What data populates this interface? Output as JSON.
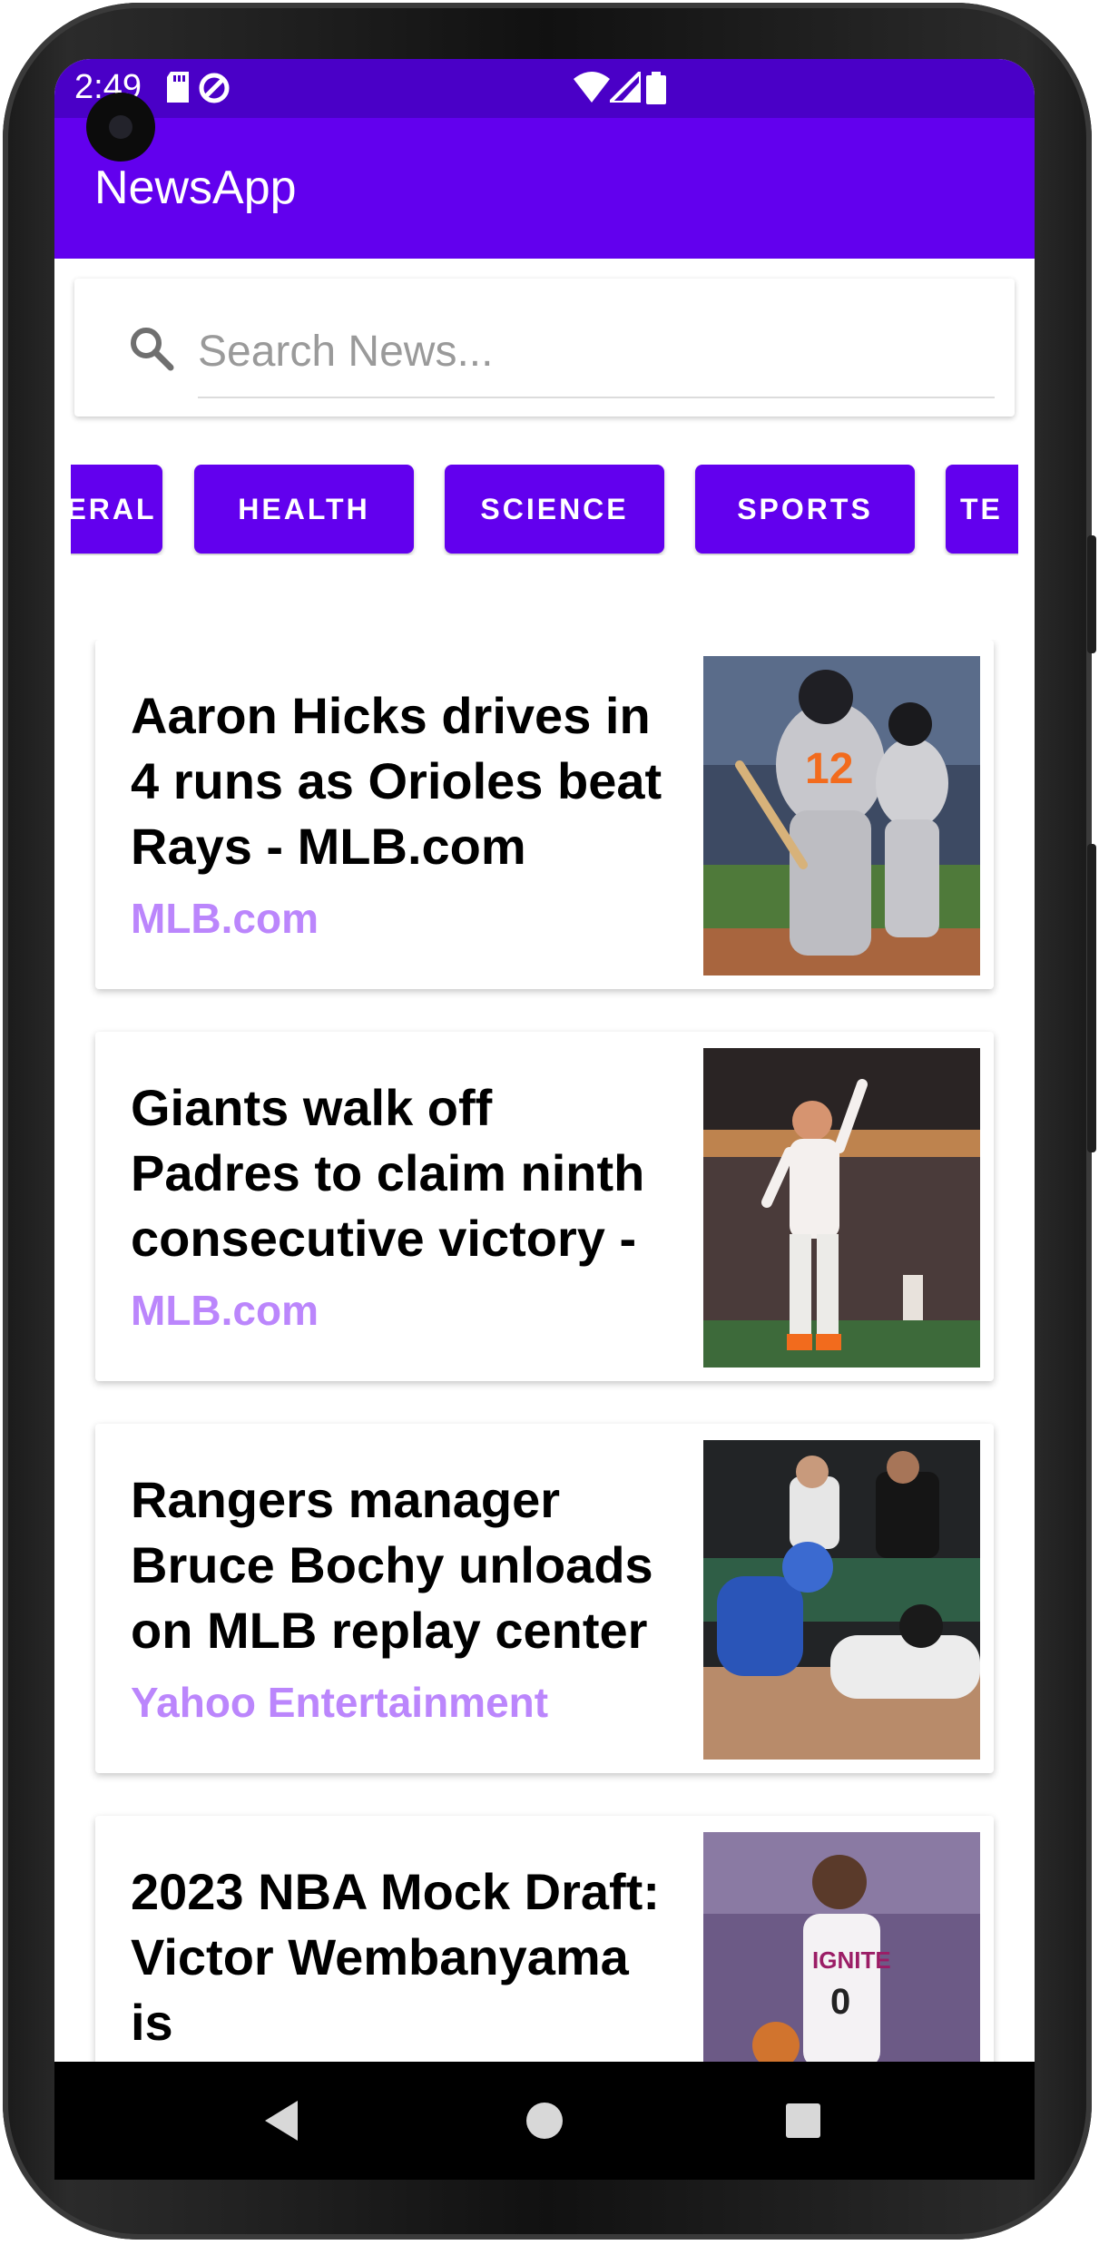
{
  "status": {
    "time": "2:49",
    "icons": [
      "sd-card-icon",
      "do-not-disturb-icon",
      "wifi-icon",
      "cell-signal-icon",
      "battery-icon"
    ]
  },
  "app": {
    "title": "NewsApp",
    "accent": "#6200ee",
    "status_bar": "#4a00c7",
    "source_color": "#bb86fc"
  },
  "search": {
    "placeholder": "Search News...",
    "value": ""
  },
  "categories": [
    {
      "label": "GENERAL",
      "visible_text": "ERAL"
    },
    {
      "label": "HEALTH"
    },
    {
      "label": "SCIENCE"
    },
    {
      "label": "SPORTS"
    },
    {
      "label": "TECHNOLOGY",
      "visible_text": "TE"
    }
  ],
  "articles": [
    {
      "title": "Aaron Hicks drives in 4 runs as Orioles beat Rays - MLB.com",
      "source": "MLB.com",
      "image": "orioles-baseball-photo"
    },
    {
      "title": "Giants walk off Padres to claim ninth consecutive victory - MLB.com",
      "source": "MLB.com",
      "image": "giants-baseball-photo"
    },
    {
      "title": "Rangers manager Bruce Bochy unloads on MLB replay center",
      "source": "Yahoo Entertainment",
      "image": "rangers-baseball-photo"
    },
    {
      "title": "2023 NBA Mock Draft: Victor Wembanyama is",
      "source": "",
      "image": "basketball-player-photo"
    }
  ],
  "nav": {
    "back": "back-icon",
    "home": "home-icon",
    "recents": "recents-icon"
  }
}
